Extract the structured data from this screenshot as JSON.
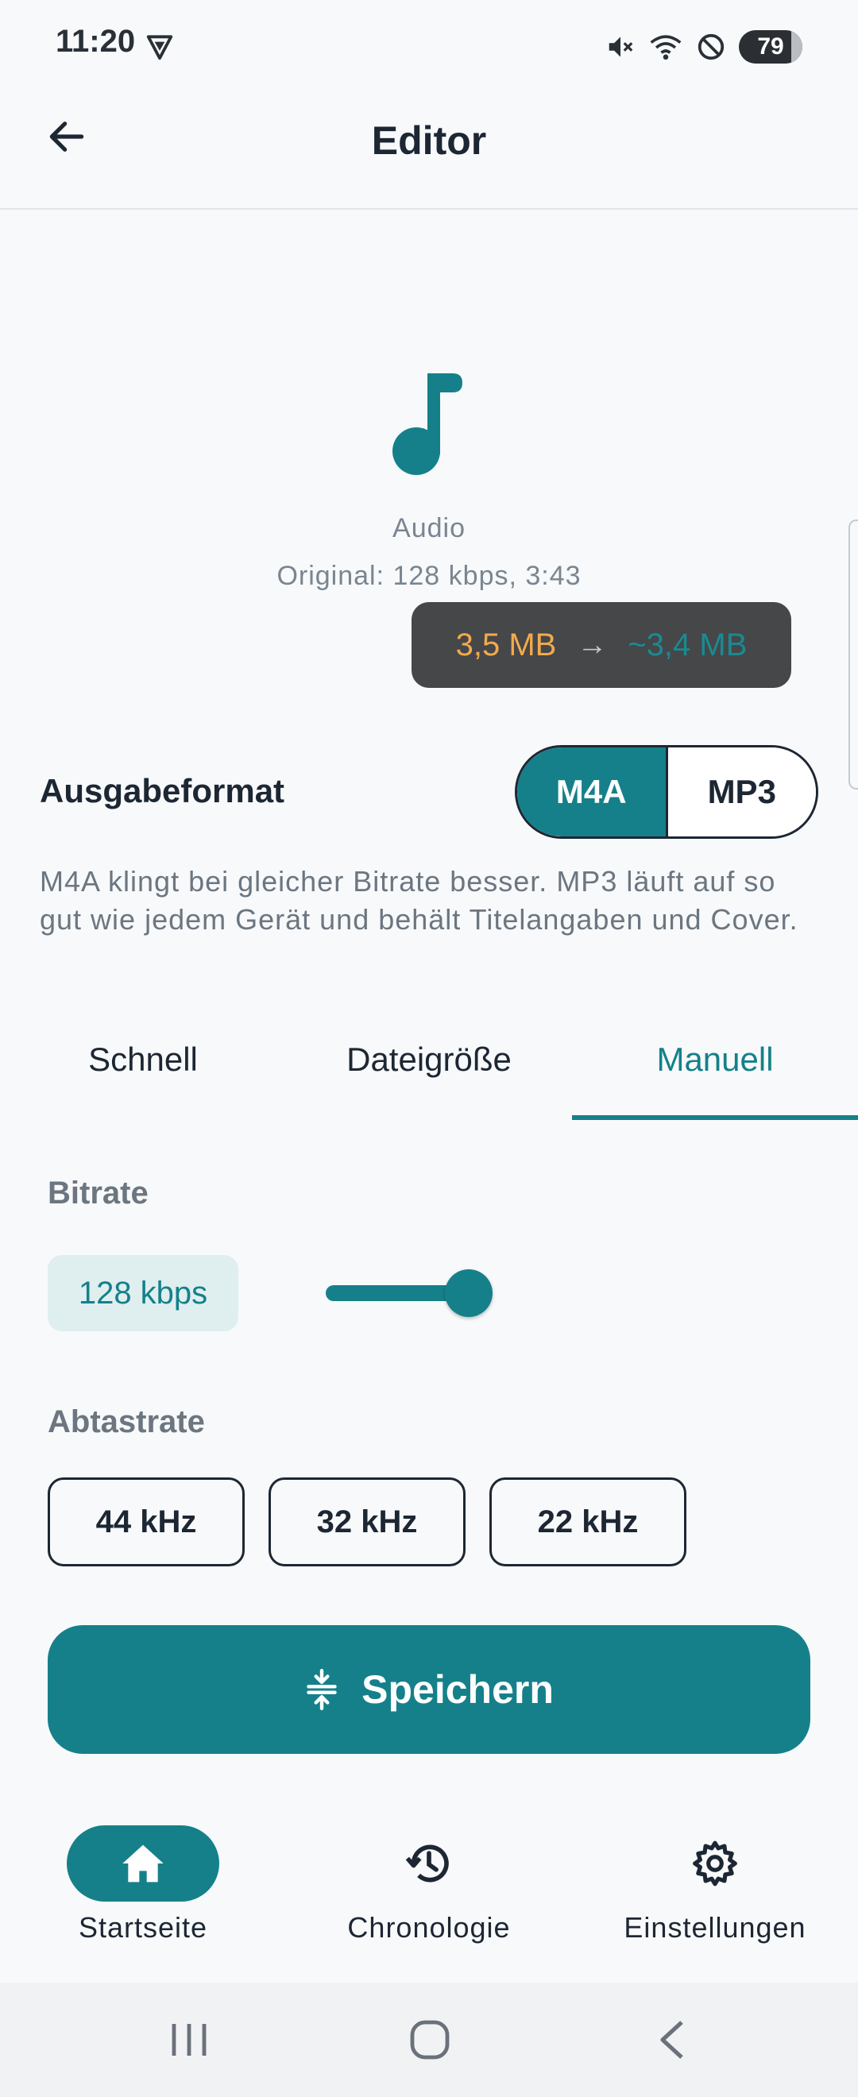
{
  "status": {
    "time": "11:20",
    "battery": "79"
  },
  "appbar": {
    "title": "Editor"
  },
  "media": {
    "type_label": "Audio",
    "original_info": "Original: 128 kbps, 3:43",
    "size_from": "3,5 MB",
    "size_arrow": "→",
    "size_to": "~3,4 MB"
  },
  "format": {
    "label": "Ausgabeformat",
    "options": [
      "M4A",
      "MP3"
    ],
    "selected": "M4A",
    "description": "M4A klingt bei gleicher Bitrate besser. MP3 läuft auf so gut wie jedem Gerät und behält Titelangaben und Cover."
  },
  "tabs": [
    {
      "label": "Schnell"
    },
    {
      "label": "Dateigröße"
    },
    {
      "label": "Manuell"
    }
  ],
  "active_tab": "Manuell",
  "bitrate": {
    "label": "Bitrate",
    "value": "128 kbps",
    "slider_fraction": 1.0
  },
  "sample_rate": {
    "label": "Abtastrate",
    "options": [
      "44 kHz",
      "32 kHz",
      "22 kHz"
    ]
  },
  "save": {
    "label": "Speichern"
  },
  "nav": [
    {
      "label": "Startseite",
      "icon": "home-icon"
    },
    {
      "label": "Chronologie",
      "icon": "history-icon"
    },
    {
      "label": "Einstellungen",
      "icon": "gear-icon"
    }
  ],
  "colors": {
    "accent": "#15808a",
    "size_from": "#f2aa4c",
    "badge_bg": "#454749"
  }
}
